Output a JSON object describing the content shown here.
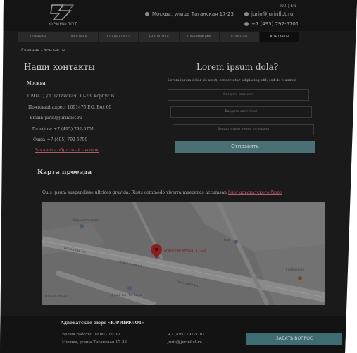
{
  "header": {
    "logo_text": "ЮРИНФЛОТ",
    "address": "Москва, улица Таганская 17-23",
    "email": "jurin@jurinflot.ru",
    "phone": "+7 (495) 792-5701",
    "lang": {
      "ru": "RU",
      "en": "EN"
    }
  },
  "nav": {
    "items": [
      "ГЛАВНАЯ",
      "ПРАКТИКА",
      "СПЕЦИАЛИСТ",
      "АНАЛИТИКА",
      "ПУБЛИКАЦИИ",
      "КЛИЕНТЫ",
      "КОНТАКТЫ"
    ]
  },
  "breadcrumb": "Главная - Контакты",
  "contacts": {
    "title": "Наши контакты",
    "city": "Москва",
    "address": "109147, ул. Таганская, 17-23, корпус B",
    "postal": "Почтовый адрес: 109147б P.O. Box 60",
    "email": "Email: jurin@jurinflot.ru",
    "phone": "Телефон: +7 (495) 792-5701",
    "fax": "Факс: +7 (495) 792-5700",
    "callback": "Заказать обратный звонок"
  },
  "form": {
    "title": "Lorem ipsum dola?",
    "subtitle": "Lorem ipsum dolor sit amet, consectetur adipiscing elit, sed do eiusmod",
    "name_placeholder": "Введите свое имя",
    "email_placeholder": "Введите свой email",
    "phone_placeholder": "Введите свой номер телефона",
    "submit": "Отправить"
  },
  "map_section": {
    "title": "Карта проезда",
    "text": "Quis ipsum suspendisse ultrices gravida. Risus commodo viverra maecenas accumsan",
    "link": "блог адвокатского бюро",
    "labels": {
      "pin": "Таганская улица, 17-23",
      "street1": "Таганская ул.",
      "street2": "Таганская ул.",
      "street3": "Таганская ул.",
      "poi1": "Евроавтосервис",
      "poi2": "Pod",
      "poi3": "Гелбакафе",
      "poi4": "Джей ван Ти Бани",
      "poi5": "Вашня стенка"
    }
  },
  "footer": {
    "title": "Адвокатское бюро «ЮРИНФЛОТ»",
    "hours": "Время работы: 09:00 - 19:00",
    "address": "Москва, улица Таганская 17-23",
    "phone": "+7 (495) 792-5701",
    "email": "jurin@jurinflot.ru",
    "button": "ЗАДАТЬ ВОПРОС"
  },
  "colors": {
    "background": "#1a1a1a",
    "accent_teal": "#4a7076",
    "link_red": "#b05a6a"
  }
}
